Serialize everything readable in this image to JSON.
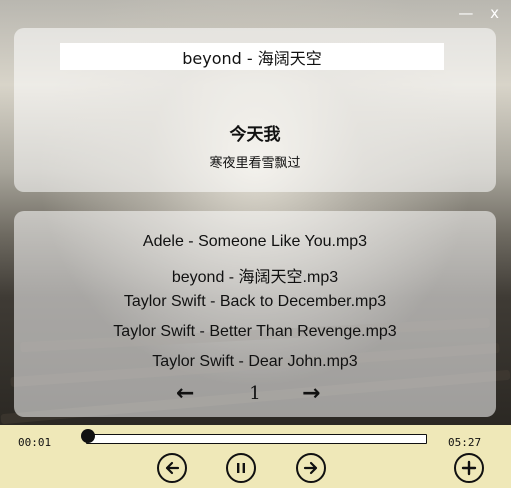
{
  "window": {
    "minimize_glyph": "—",
    "close_glyph": "x"
  },
  "now_playing": {
    "title": "beyond - 海阔天空",
    "lyric_line": "今天我",
    "lyric_next": "寒夜里看雪飘过"
  },
  "playlist": {
    "tracks": [
      "Adele - Someone Like You.mp3",
      "beyond - 海阔天空.mp3",
      "Taylor Swift - Back to December.mp3",
      "Taylor Swift - Better Than Revenge.mp3",
      "Taylor Swift - Dear John.mp3"
    ],
    "selected_index": 0,
    "prev_glyph": "←",
    "next_glyph": "→",
    "page": "1"
  },
  "player": {
    "current_time": "00:01",
    "total_time": "05:27",
    "progress": 0.003
  },
  "icons": {
    "previous": "arrow-left-circle-icon",
    "pause": "pause-circle-icon",
    "next": "arrow-right-circle-icon",
    "add": "plus-circle-icon"
  }
}
